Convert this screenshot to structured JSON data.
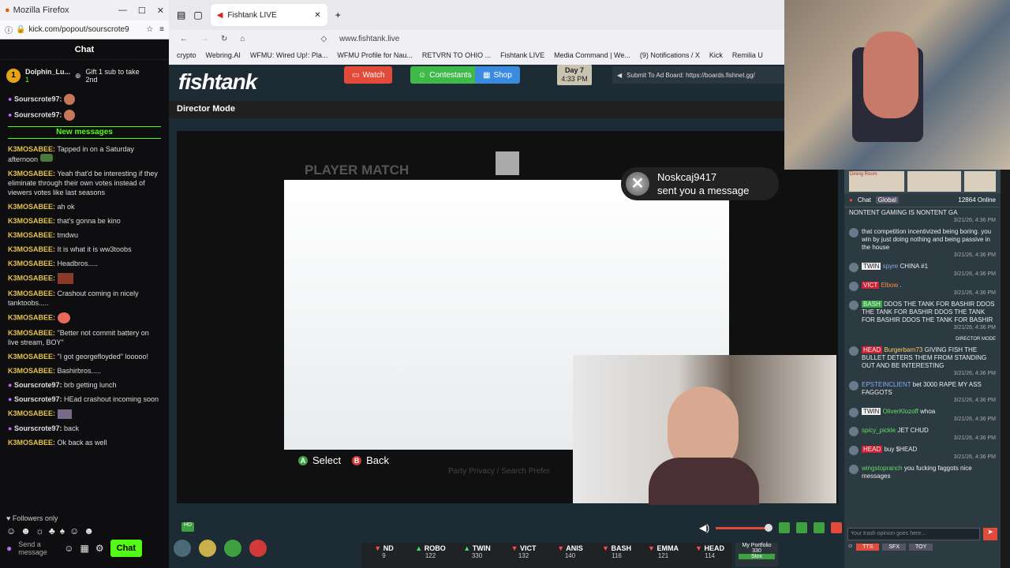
{
  "kick": {
    "window_title": "Mozilla Firefox",
    "url": "kick.com/popout/sourscrote9",
    "chat_title": "Chat",
    "gift_user": "Dolphin_Lu...",
    "gift_count": "1",
    "gift_text": "Gift 1 sub to take 2nd",
    "new_messages": "New messages",
    "messages": [
      {
        "user": "Sourscrote97:",
        "text": ""
      },
      {
        "user": "Sourscrote97:",
        "text": ""
      },
      {
        "user": "K3MOSABEE:",
        "text": "Tapped in on a Saturday afternoon"
      },
      {
        "user": "K3MOSABEE:",
        "text": "Yeah that'd be interesting if they eliminate through their own votes instead of viewers votes like last seasons"
      },
      {
        "user": "K3MOSABEE:",
        "text": "ah ok"
      },
      {
        "user": "K3MOSABEE:",
        "text": "that's gonna be kino"
      },
      {
        "user": "K3MOSABEE:",
        "text": "tmdwu"
      },
      {
        "user": "K3MOSABEE:",
        "text": "It is what it is ww3toobs"
      },
      {
        "user": "K3MOSABEE:",
        "text": "Headbros....."
      },
      {
        "user": "K3MOSABEE:",
        "text": ""
      },
      {
        "user": "K3MOSABEE:",
        "text": "Crashout coming in nicely tanktoobs....."
      },
      {
        "user": "K3MOSABEE:",
        "text": ""
      },
      {
        "user": "K3MOSABEE:",
        "text": "\"Better not commit battery on live stream, BOY\""
      },
      {
        "user": "K3MOSABEE:",
        "text": "\"I got georgefloyded\" looooo!"
      },
      {
        "user": "K3MOSABEE:",
        "text": "Bashirbros....."
      },
      {
        "user": "Sourscrote97:",
        "text": "brb getting lunch"
      },
      {
        "user": "Sourscrote97:",
        "text": "HEad crashout incoming soon"
      },
      {
        "user": "K3MOSABEE:",
        "text": ""
      },
      {
        "user": "Sourscrote97:",
        "text": "back"
      },
      {
        "user": "K3MOSABEE:",
        "text": "Ok back as well"
      }
    ],
    "followers_only": "Followers only",
    "send_placeholder": "Send a message",
    "chat_button": "Chat"
  },
  "browser": {
    "tab_title": "Fishtank LIVE",
    "url": "www.fishtank.live",
    "bookmarks": [
      "crypto",
      "Webring.AI",
      "WFMU: Wired Up!: Pla...",
      "WFMU Profile for Nau...",
      "RETVRN TO OHIO ...",
      "Fishtank LIVE",
      "Media Command | We...",
      "(9) Notifications / X",
      "Kick",
      "Remilia U"
    ]
  },
  "site": {
    "logo": "fishtank",
    "watch": "Watch",
    "contestants": "Contestants",
    "shop": "Shop",
    "day": "Day 7",
    "time": "4:33 PM",
    "ad_board": "Submit To Ad Board: https://boards.fishnet.gg/",
    "director_mode": "Director Mode",
    "player_match": "PLAYER MATCH",
    "xbox_sender": "Noskcaj9417",
    "xbox_msg": "sent you a message",
    "select": "Select",
    "back": "Back",
    "party": "Party Privacy / Search Prefer"
  },
  "right": {
    "chat_tab": "Chat",
    "global_tab": "Global",
    "online": "12864 Online",
    "messages": [
      {
        "tag": "",
        "user": "",
        "text": "NONTENT GAMING IS NONTENT GA",
        "time": "3/21/26, 4:36 PM"
      },
      {
        "tag": "",
        "user": "",
        "text": "that competition incentivized being boring. you win by just doing nothing and being passive in the house",
        "time": "3/21/26, 4:36 PM"
      },
      {
        "tag": "TWIN",
        "user": "spyre",
        "text": "CHINA #1",
        "time": "3/21/26, 4:36 PM"
      },
      {
        "tag": "VICT",
        "user": "Elbow",
        "text": ".",
        "time": "3/21/26, 4:36 PM"
      },
      {
        "tag": "BASH",
        "user": "",
        "text": "DDOS THE TANK FOR BASHIR DDOS THE TANK FOR BASHIR DDOS THE TANK FOR BASHIR DDOS THE TANK FOR BASHIR",
        "time": "3/21/26, 4:36 PM"
      },
      {
        "tag": "HEAD",
        "user": "Burgerbarn73",
        "text": "GIVING FISH THE BULLET DETERS THEM FROM STANDING OUT AND BE INTERESTING",
        "time": "3/21/26, 4:36 PM"
      },
      {
        "tag": "",
        "user": "EPSTEINCLIENT",
        "text": "bet 3000 RAPE MY ASS FAGGOTS",
        "time": "3/21/26, 4:36 PM"
      },
      {
        "tag": "TWIN",
        "user": "OliverKlozoff",
        "text": "whoa",
        "time": "3/21/26, 4:36 PM"
      },
      {
        "tag": "",
        "user": "spicy_pickle",
        "text": "JET CHUD",
        "time": "3/21/26, 4:36 PM"
      },
      {
        "tag": "HEAD",
        "user": "",
        "text": "buy $HEAD",
        "time": "3/21/26, 4:36 PM"
      },
      {
        "tag": "",
        "user": "wingstopranch",
        "text": "you fucking faggots nice messages",
        "time": "3/21/26, 4:36 PM"
      }
    ],
    "director_label": "DIRECTOR MODE",
    "input_placeholder": "Your trash opinion goes here...",
    "tts": "TTS",
    "sfx": "SFX",
    "toy": "TOY"
  },
  "stocks": [
    {
      "name": "ND",
      "value": "9",
      "dir": "dn"
    },
    {
      "name": "ROBO",
      "value": "122",
      "dir": "up"
    },
    {
      "name": "TWIN",
      "value": "330",
      "dir": "up"
    },
    {
      "name": "VICT",
      "value": "132",
      "dir": "dn"
    },
    {
      "name": "ANIS",
      "value": "140",
      "dir": "dn"
    },
    {
      "name": "BASH",
      "value": "116",
      "dir": "dn"
    },
    {
      "name": "EMMA",
      "value": "121",
      "dir": "dn"
    },
    {
      "name": "HEAD",
      "value": "114",
      "dir": "dn"
    }
  ],
  "portfolio": {
    "label": "My Portfolio",
    "value": "330",
    "button": "Stox"
  }
}
